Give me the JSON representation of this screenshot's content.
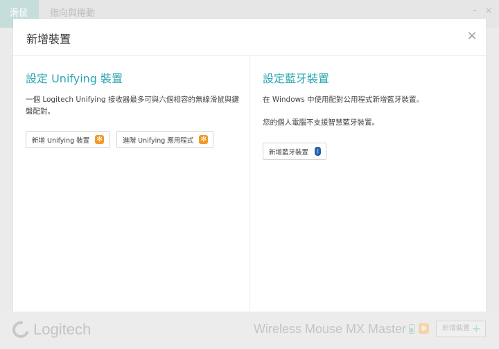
{
  "app": {
    "tabs": [
      {
        "label": "滑鼠"
      },
      {
        "label": "指向與捲動"
      }
    ],
    "window_controls": {
      "minimize": "–",
      "close": "×"
    },
    "footer": {
      "logo_text": "Logitech",
      "device_name": "Wireless Mouse MX Master",
      "add_device_label": "新增裝置",
      "add_icon": "+"
    }
  },
  "dialog": {
    "title": "新增裝置",
    "close_icon": "×",
    "unifying": {
      "title": "設定 Unifying 裝置",
      "description": "一個 Logitech Unifying 接收器最多可與六個相容的無線滑鼠與鍵盤配對。",
      "add_button": "新增 Unifying 裝置",
      "advanced_button": "進階 Unifying 應用程式",
      "icon_glyph": "✻"
    },
    "bluetooth": {
      "title": "設定藍牙裝置",
      "description": "在 Windows 中使用配對公用程式新增藍牙裝置。",
      "note": "您的個人電腦不支援智慧藍牙裝置。",
      "add_button": "新增藍牙裝置",
      "icon_glyph": "ᛒ"
    }
  },
  "colors": {
    "accent": "#2ca6b2",
    "unifying_orange": "#f29b2a",
    "bluetooth_blue": "#2460a7"
  }
}
